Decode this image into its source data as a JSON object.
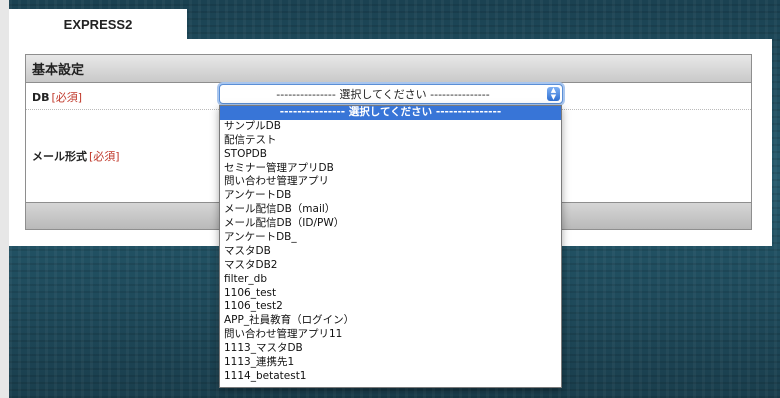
{
  "tab": {
    "label": "EXPRESS2"
  },
  "section": {
    "title": "基本設定"
  },
  "fields": {
    "db": {
      "label": "DB",
      "required": "[必須]"
    },
    "mail_format": {
      "label": "メール形式",
      "required": "[必須]"
    }
  },
  "select": {
    "value": "--------------- 選択してください ---------------",
    "options": [
      "--------------- 選択してください ---------------",
      "サンプルDB",
      "配信テスト",
      "STOPDB",
      "セミナー管理アプリDB",
      "問い合わせ管理アプリ",
      "アンケートDB",
      "メール配信DB（mail）",
      "メール配信DB（ID/PW）",
      "アンケートDB_",
      "マスタDB",
      "マスタDB2",
      "filter_db",
      "1106_test",
      "1106_test2",
      "APP_社員教育（ログイン）",
      "問い合わせ管理アプリ11",
      "1113_マスタDB",
      "1113_連携先1",
      "1114_betatest1"
    ]
  },
  "colors": {
    "accent": "#3875d7",
    "required": "#c0392b",
    "background": "#1f4a5c"
  }
}
